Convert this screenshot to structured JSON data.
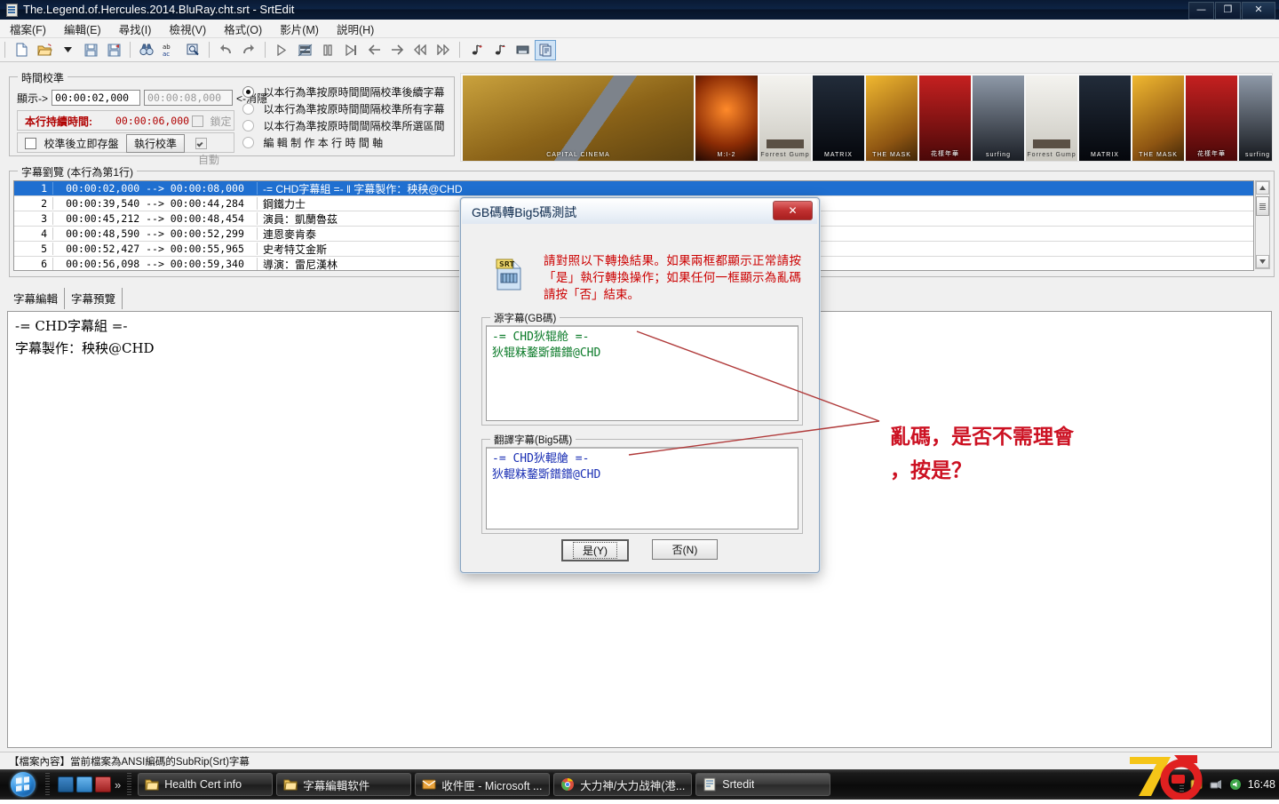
{
  "window": {
    "title": "The.Legend.of.Hercules.2014.BluRay.cht.srt - SrtEdit",
    "icon": "srt-file-icon",
    "buttons": {
      "minimize": "—",
      "maximize": "❐",
      "close": "✕"
    }
  },
  "menubar": {
    "items": [
      {
        "label": "檔案(F)",
        "name": "menu-file"
      },
      {
        "label": "編輯(E)",
        "name": "menu-edit"
      },
      {
        "label": "尋找(I)",
        "name": "menu-find"
      },
      {
        "label": "檢視(V)",
        "name": "menu-view"
      },
      {
        "label": "格式(O)",
        "name": "menu-format"
      },
      {
        "label": "影片(M)",
        "name": "menu-movie"
      },
      {
        "label": "説明(H)",
        "name": "menu-help"
      }
    ]
  },
  "toolbar": {
    "buttons": [
      {
        "name": "new-file-icon",
        "tip": "新建"
      },
      {
        "name": "open-folder-icon",
        "tip": "開啟"
      },
      {
        "name": "open-dropdown-icon",
        "tip": "最近檔案"
      },
      {
        "name": "save-icon",
        "tip": "儲存"
      },
      {
        "name": "save-as-icon",
        "tip": "另存新檔"
      },
      {
        "name": "find-binoculars-icon",
        "tip": "尋找"
      },
      {
        "name": "replace-abac-icon",
        "tip": "取代"
      },
      {
        "name": "goto-magnifier-icon",
        "tip": "跳轉"
      },
      {
        "name": "undo-icon",
        "tip": "復原"
      },
      {
        "name": "redo-icon",
        "tip": "重做"
      },
      {
        "name": "play-icon",
        "tip": "播放"
      },
      {
        "name": "film-strip-icon",
        "tip": "影片"
      },
      {
        "name": "pause-icon",
        "tip": "暫停"
      },
      {
        "name": "skip-end-icon",
        "tip": "跳至結尾"
      },
      {
        "name": "arrow-left-icon",
        "tip": "上一句"
      },
      {
        "name": "arrow-right-icon",
        "tip": "下一句"
      },
      {
        "name": "rewind-icon",
        "tip": "快退"
      },
      {
        "name": "fast-forward-icon",
        "tip": "快進"
      },
      {
        "name": "audio-add-icon",
        "tip": "增加音量"
      },
      {
        "name": "audio-remove-icon",
        "tip": "降低音量"
      },
      {
        "name": "stop-icon",
        "tip": "停止"
      },
      {
        "name": "encoding-convert-icon",
        "tip": "編碼轉換"
      }
    ]
  },
  "time_calibration": {
    "group_title": "時間校準",
    "show_label": "顯示->",
    "show_value": "00:00:02,000",
    "hide_value": "00:00:08,000",
    "hide_label": "<-消隱",
    "duration_label": "本行持續時間:",
    "duration_value": "00:00:06,000",
    "lock_label": "鎖定",
    "lock_checked": false,
    "save_after_label": "校準後立即存盤",
    "save_after_checked": false,
    "run_button": "執行校準",
    "auto_label": "自動",
    "auto_checked": true,
    "radio_options": [
      {
        "label": "以本行為準按原時間間隔校準後續字幕",
        "selected": true
      },
      {
        "label": "以本行為準按原時間間隔校準所有字幕",
        "selected": false
      },
      {
        "label": "以本行為準按原時間間隔校準所選區間",
        "selected": false
      },
      {
        "label": "編 輯 制 作 本 行 時 間 軸",
        "selected": false
      }
    ]
  },
  "poster_strip": {
    "name": "movie-poster-banner",
    "posters": [
      {
        "caption": "CAPITAL CINEMA",
        "c1": "#c8a040",
        "c2": "#6d4a18"
      },
      {
        "caption": "M:I-2",
        "c1": "#e05a14",
        "c2": "#2a1005"
      },
      {
        "caption": "Forrest Gump",
        "c1": "#f3f2ee",
        "c2": "#b8b6ae"
      },
      {
        "caption": "MATRIX",
        "c1": "#1c2430",
        "c2": "#05070b"
      },
      {
        "caption": "THE MASK",
        "c1": "#e0a820",
        "c2": "#7a4a10"
      },
      {
        "caption": "花樣年華",
        "c1": "#b01a1a",
        "c2": "#3a0606"
      },
      {
        "caption": "surfing",
        "c1": "#7c8796",
        "c2": "#1b1f26"
      },
      {
        "caption": "Forrest Gump",
        "c1": "#f3f2ee",
        "c2": "#b8b6ae"
      },
      {
        "caption": "MATRIX",
        "c1": "#1c2430",
        "c2": "#05070b"
      },
      {
        "caption": "THE MASK",
        "c1": "#e0a820",
        "c2": "#7a4a10"
      },
      {
        "caption": "花樣年華",
        "c1": "#b01a1a",
        "c2": "#3a0606"
      },
      {
        "caption": "surfing",
        "c1": "#7c8796",
        "c2": "#1b1f26"
      }
    ]
  },
  "subtitle_list": {
    "group_title": "字幕劉覽 (本行為第1行)",
    "rows": [
      {
        "index": "1",
        "time": "00:00:02,000 --> 00:00:08,000",
        "text": "-= CHD字幕組 =- ‖ 字幕製作：秧秧@CHD",
        "selected": true
      },
      {
        "index": "2",
        "time": "00:00:39,540 --> 00:00:44,284",
        "text": "鋼鐵力士",
        "selected": false
      },
      {
        "index": "3",
        "time": "00:00:45,212 --> 00:00:48,454",
        "text": "演員：凱蘭魯茲",
        "selected": false
      },
      {
        "index": "4",
        "time": "00:00:48,590 --> 00:00:52,299",
        "text": "連恩麥肯泰",
        "selected": false
      },
      {
        "index": "5",
        "time": "00:00:52,427 --> 00:00:55,965",
        "text": "史考特艾金斯",
        "selected": false
      },
      {
        "index": "6",
        "time": "00:00:56,098 --> 00:00:59,340",
        "text": "導演：雷尼漢林",
        "selected": false
      }
    ]
  },
  "editor": {
    "tabs": [
      {
        "label": "字幕編輯",
        "active": true
      },
      {
        "label": "字幕預覽",
        "active": false
      }
    ],
    "lines": [
      "-= CHD字幕組 =-",
      "字幕製作：秧秧@CHD"
    ]
  },
  "statusbar": {
    "text": "【檔案內容】當前檔案為ANSI編碼的SubRip(Srt)字幕"
  },
  "dialog": {
    "title": "GB碼轉Big5碼測試",
    "close_label": "✕",
    "icon": "srt-document-icon",
    "message": "請對照以下轉換結果。如果兩框都顯示正常請按「是」執行轉換操作；如果任何一框顯示為亂碼請按「否」結束。",
    "source_group": "源字幕(GB碼)",
    "source_lines": [
      "-= CHD狄辊舱 =-",
      "狄辊粖鍪斲鐠鐠@CHD"
    ],
    "target_group": "翻譯字幕(Big5碼)",
    "target_lines": [
      "-= CHD狄輥艙 =-",
      "狄輥粖鍪斲鐠鐠@CHD"
    ],
    "yes_button": "是(Y)",
    "no_button": "否(N)"
  },
  "annotation": {
    "text": "亂碼，是否不需理會\n，按是？",
    "color": "#cc1122",
    "line_color": "#b03a3a"
  },
  "taskbar": {
    "start_label": "start-orb",
    "quick_launch": [
      {
        "name": "ql-media-icon",
        "color": "#2c6fae"
      },
      {
        "name": "ql-desktop-icon",
        "color": "#3f90d8"
      },
      {
        "name": "ql-ie-icon",
        "color": "#c23b3b"
      }
    ],
    "overflow": "»",
    "items": [
      {
        "label": "Health Cert info",
        "icon": "folder-icon",
        "active": false
      },
      {
        "label": "字幕編輯软件",
        "icon": "folder-icon",
        "active": false
      },
      {
        "label": "收件匣 - Microsoft ...",
        "icon": "outlook-icon",
        "active": false
      },
      {
        "label": "大力神/大力战神(港...",
        "icon": "chrome-icon",
        "active": false
      },
      {
        "label": "Srtedit",
        "icon": "srt-file-icon",
        "active": true
      }
    ],
    "tray": {
      "clock": "16:48",
      "icons": [
        "network-icon",
        "volume-icon",
        "action-center-icon"
      ]
    },
    "watermark": "76"
  }
}
